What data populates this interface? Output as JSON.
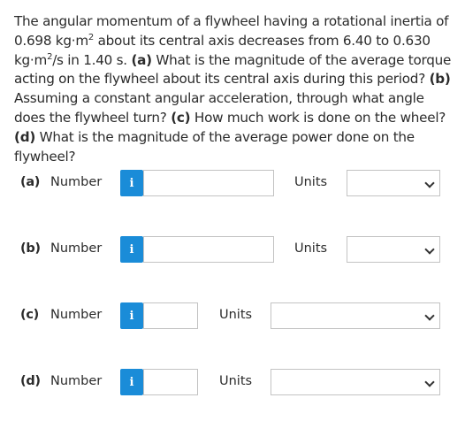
{
  "question": {
    "t1": "The angular momentum of a flywheel having a rotational inertia of 0.698 kg·m",
    "t2": " about its central axis decreases from 6.40 to 0.630 kg·m",
    "t3": "/s in 1.40 s. ",
    "a_tag": "(a)",
    "t4": " What is the magnitude of the average torque acting on the flywheel about its central axis during this period? ",
    "b_tag": "(b)",
    "t5": " Assuming a constant angular acceleration, through what angle does the flywheel turn? ",
    "c_tag": "(c)",
    "t6": " How much work is done on the wheel? ",
    "d_tag": "(d)",
    "t7": " What is the magnitude of the average power done on the flywheel?",
    "sup": "2"
  },
  "parts": [
    {
      "tag": "(a)",
      "number_label": "Number",
      "info": "i",
      "value": "",
      "units_label": "Units",
      "units_selected": ""
    },
    {
      "tag": "(b)",
      "number_label": "Number",
      "info": "i",
      "value": "",
      "units_label": "Units",
      "units_selected": ""
    },
    {
      "tag": "(c)",
      "number_label": "Number",
      "info": "i",
      "value": "",
      "units_label": "Units",
      "units_selected": ""
    },
    {
      "tag": "(d)",
      "number_label": "Number",
      "info": "i",
      "value": "",
      "units_label": "Units",
      "units_selected": ""
    }
  ],
  "colors": {
    "info_button": "#1a8cd8",
    "border": "#c3c3c3"
  },
  "icons": {
    "info": "info-icon",
    "dropdown": "chevron-down-icon"
  }
}
